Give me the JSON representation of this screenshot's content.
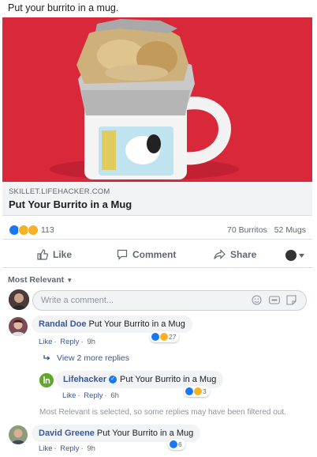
{
  "post": {
    "text": "Put your burrito in a mug."
  },
  "link": {
    "domain": "SKILLET.LIFEHACKER.COM",
    "title": "Put Your Burrito in a Mug"
  },
  "stats": {
    "reaction_count": "113",
    "comments": "70 Burritos",
    "shares": "52 Mugs"
  },
  "actions": {
    "like": "Like",
    "comment": "Comment",
    "share": "Share"
  },
  "sort": {
    "label": "Most Relevant"
  },
  "composer": {
    "placeholder": "Write a comment..."
  },
  "comments": [
    {
      "author": "Randal Doe",
      "text": "Put Your Burrito in a Mug",
      "like": "Like",
      "reply": "Reply",
      "time": "9h",
      "reactions": "27"
    },
    {
      "author": "David Greene",
      "text": "Put Your Burrito in a Mug",
      "like": "Like",
      "reply": "Reply",
      "time": "9h",
      "reactions": "6"
    }
  ],
  "more_replies": "View 2 more replies",
  "reply": {
    "author": "Lifehacker",
    "text": "Put Your Burrito in a Mug",
    "like": "Like",
    "reply": "Reply",
    "time": "6h",
    "reactions": "3"
  },
  "filter_note": "Most Relevant is selected, so some replies may have been filtered out.",
  "colors": {
    "accent": "#1877f2",
    "link_blue": "#385898",
    "media_bg": "#d8283a"
  }
}
